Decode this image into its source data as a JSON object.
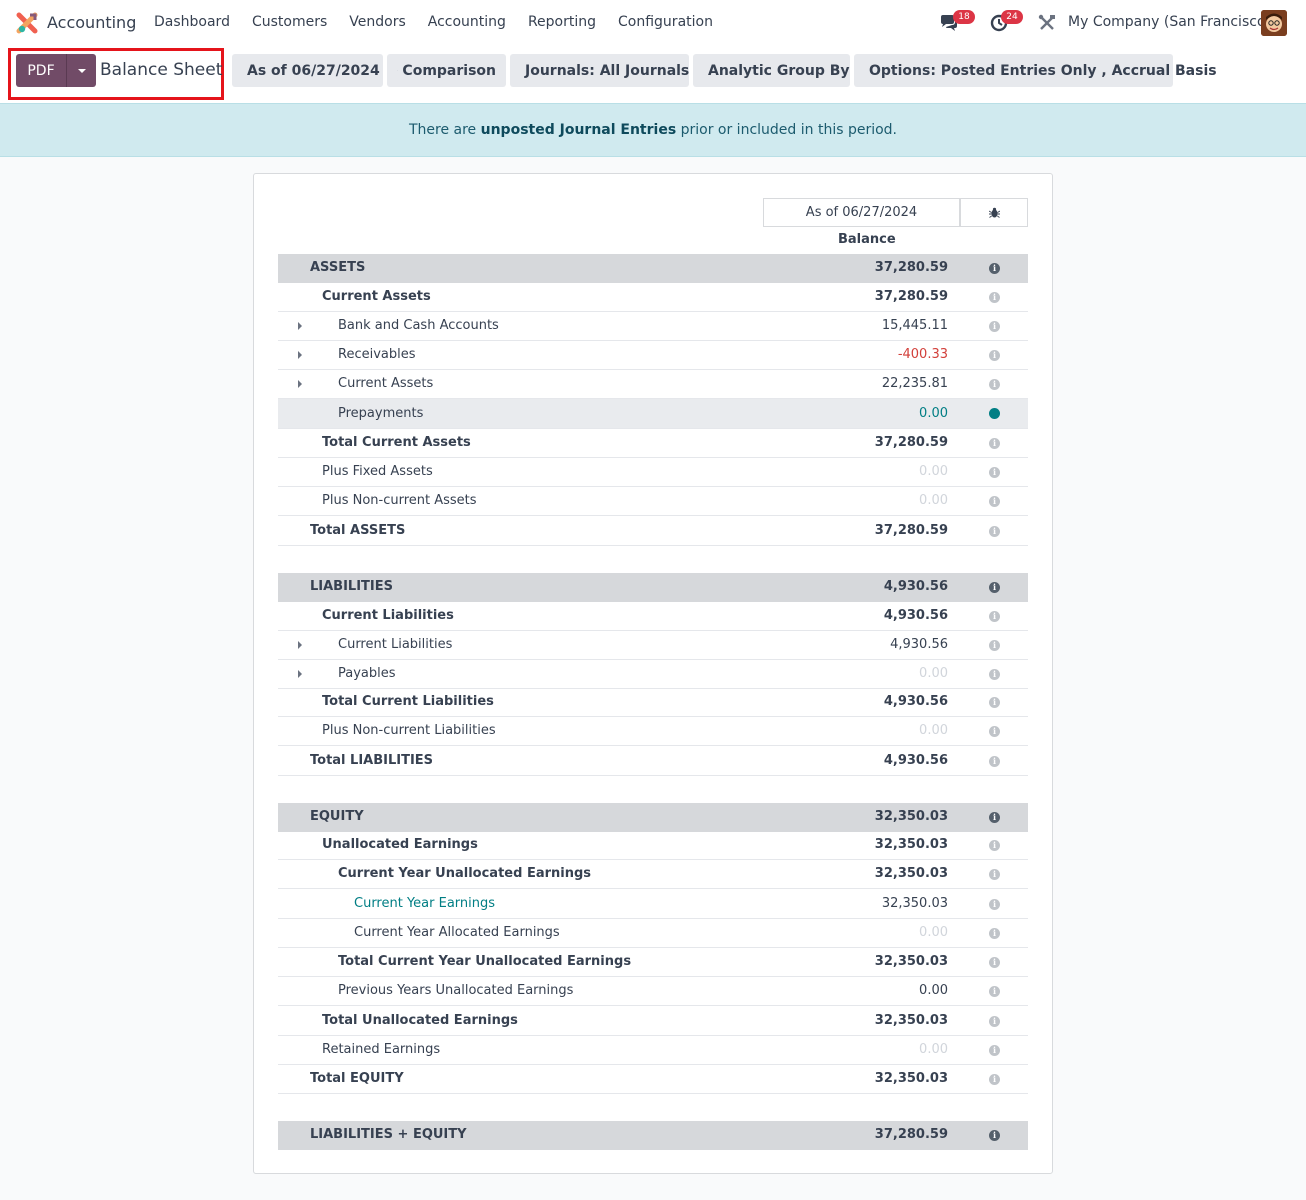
{
  "navbar": {
    "app_name": "Accounting",
    "menu": [
      "Dashboard",
      "Customers",
      "Vendors",
      "Accounting",
      "Reporting",
      "Configuration"
    ],
    "messages_count": "18",
    "activities_count": "24",
    "company": "My Company (San Francisco)"
  },
  "control_panel": {
    "pdf_label": "PDF",
    "title": "Balance Sheet",
    "date_filter": "As of 06/27/2024",
    "comparison": "Comparison",
    "journals": "Journals: All Journals",
    "analytic": "Analytic Group By",
    "options": "Options: Posted Entries Only , Accrual Basis"
  },
  "alert": {
    "before": "There are ",
    "link": "unposted Journal Entries",
    "after": " prior or included in this period."
  },
  "report": {
    "column_date": "As of 06/27/2024",
    "column_label": "Balance",
    "rows": [
      {
        "label": "ASSETS",
        "value": "37,280.59"
      },
      {
        "label": "Current Assets",
        "value": "37,280.59"
      },
      {
        "label": "Bank and Cash Accounts",
        "value": "15,445.11"
      },
      {
        "label": "Receivables",
        "value": "-400.33"
      },
      {
        "label": "Current Assets",
        "value": "22,235.81"
      },
      {
        "label": "Prepayments",
        "value": "0.00"
      },
      {
        "label": "Total Current Assets",
        "value": "37,280.59"
      },
      {
        "label": "Plus Fixed Assets",
        "value": "0.00"
      },
      {
        "label": "Plus Non-current Assets",
        "value": "0.00"
      },
      {
        "label": "Total ASSETS",
        "value": "37,280.59"
      },
      {
        "label": "LIABILITIES",
        "value": "4,930.56"
      },
      {
        "label": "Current Liabilities",
        "value": "4,930.56"
      },
      {
        "label": "Current Liabilities",
        "value": "4,930.56"
      },
      {
        "label": "Payables",
        "value": "0.00"
      },
      {
        "label": "Total Current Liabilities",
        "value": "4,930.56"
      },
      {
        "label": "Plus Non-current Liabilities",
        "value": "0.00"
      },
      {
        "label": "Total LIABILITIES",
        "value": "4,930.56"
      },
      {
        "label": "EQUITY",
        "value": "32,350.03"
      },
      {
        "label": "Unallocated Earnings",
        "value": "32,350.03"
      },
      {
        "label": "Current Year Unallocated Earnings",
        "value": "32,350.03"
      },
      {
        "label": "Current Year Earnings",
        "value": "32,350.03"
      },
      {
        "label": "Current Year Allocated Earnings",
        "value": "0.00"
      },
      {
        "label": "Total Current Year Unallocated Earnings",
        "value": "32,350.03"
      },
      {
        "label": "Previous Years Unallocated Earnings",
        "value": "0.00"
      },
      {
        "label": "Total Unallocated Earnings",
        "value": "32,350.03"
      },
      {
        "label": "Retained Earnings",
        "value": "0.00"
      },
      {
        "label": "Total EQUITY",
        "value": "32,350.03"
      },
      {
        "label": "LIABILITIES + EQUITY",
        "value": "37,280.59"
      }
    ]
  },
  "colors": {
    "brand": "#714b67",
    "negative": "#d23f3a",
    "link": "#017e84",
    "highlight_border": "#e5141b"
  }
}
